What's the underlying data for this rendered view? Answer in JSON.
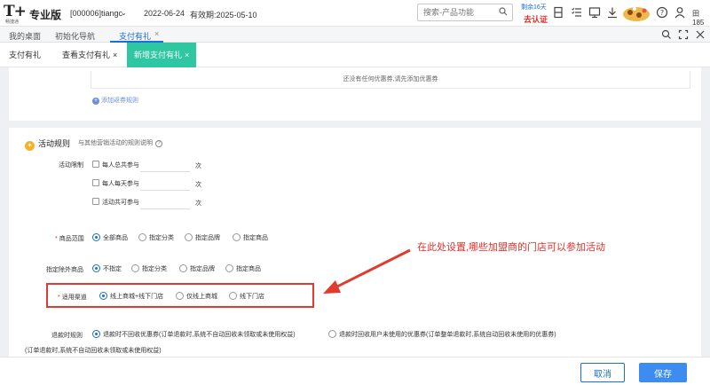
{
  "header": {
    "logo_text": "T+",
    "logo_sub": "畅捷通",
    "edition": "专业版",
    "account": "[000006]tiangc",
    "date": "2022-06-24",
    "expiry": "有效期:2025-05-10",
    "search_placeholder": "搜索-产品功能",
    "remaining_days": "剩余16天",
    "certify": "去认证",
    "user_count": "185"
  },
  "nav": {
    "tabs": [
      {
        "label": "我的桌面"
      },
      {
        "label": "初始化导航"
      },
      {
        "label": "支付有礼"
      }
    ],
    "close": "×"
  },
  "subtabs": {
    "items": [
      {
        "label": "支付有礼"
      },
      {
        "label": "查看支付有礼"
      },
      {
        "label": "新增支付有礼"
      }
    ],
    "close": "×"
  },
  "coupon": {
    "empty_text": "还没有任何优惠券,请先添加优惠券",
    "add_rule": "添加返券规则"
  },
  "rules": {
    "title": "活动规则",
    "desc": "与其他营销活动的规则说明",
    "limit_label": "活动限制",
    "limit_options": [
      "每人总共参与",
      "每人每天参与",
      "活动共可参与"
    ],
    "unit": "次",
    "scope_label": "商品范围",
    "scope_options": [
      "全部商品",
      "指定分类",
      "指定品牌",
      "指定商品"
    ],
    "exclude_label": "指定除外商品",
    "exclude_options": [
      "不指定",
      "指定分类",
      "指定品牌",
      "指定商品"
    ],
    "channel_label": "适用渠道",
    "channel_options": [
      "线上商城+线下门店",
      "仅线上商城",
      "线下门店"
    ],
    "refund_label": "退款时规则",
    "refund_options": [
      "退款时不回收优惠券(订单退款时,系统不自动回收未领取或未使用权益)",
      "退款时回收用户未使用的优惠券(订单整单退款时,系统自动回收未使用的优惠券)"
    ],
    "refund_note": "(订单退款时,系统不自动回收未领取或未使用权益)"
  },
  "annotation": "在此处设置,哪些加盟商的门店可以参加活动",
  "footer": {
    "cancel": "取消",
    "save": "保存"
  },
  "colors": {
    "accent": "#1a6ed8",
    "active_subtab": "#2ec7a2",
    "annotation": "#e0312a"
  }
}
